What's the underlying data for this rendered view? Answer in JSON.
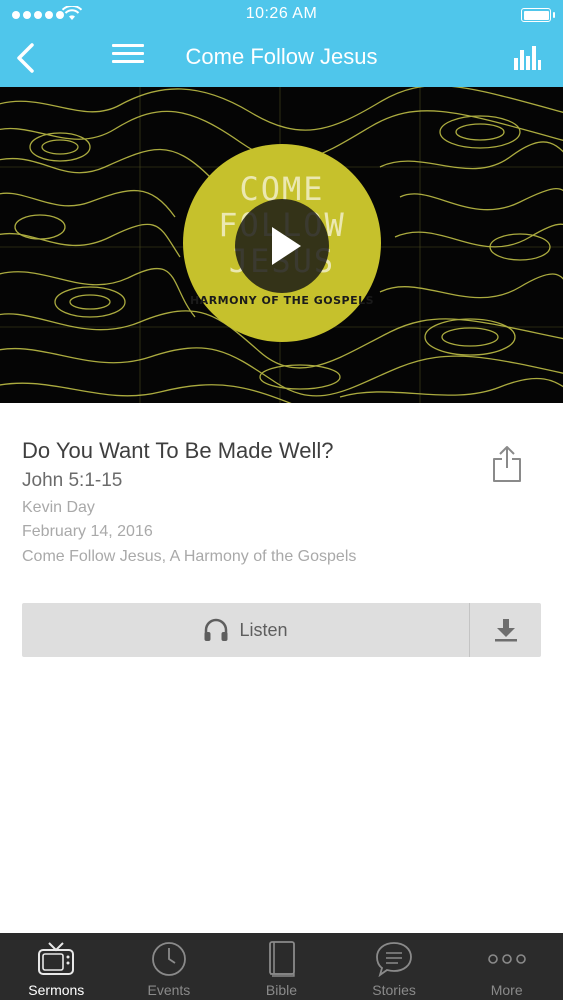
{
  "status_bar": {
    "time": "10:26 AM"
  },
  "nav": {
    "title": "Come Follow Jesus"
  },
  "artwork": {
    "title_lines": [
      "COME",
      "FOLLOW",
      "JESUS"
    ],
    "subtitle": "HARMONY OF THE GOSPELS",
    "circle_color": "#c6c12c",
    "line_color": "#c8c84a"
  },
  "sermon": {
    "title": "Do You Want To Be Made Well?",
    "scripture": "John 5:1-15",
    "speaker": "Kevin Day",
    "date": "February 14, 2016",
    "series": "Come Follow Jesus, A Harmony of the Gospels"
  },
  "actions": {
    "listen_label": "Listen"
  },
  "tabs": [
    {
      "label": "Sermons",
      "icon": "tv-icon",
      "active": true
    },
    {
      "label": "Events",
      "icon": "clock-icon",
      "active": false
    },
    {
      "label": "Bible",
      "icon": "book-icon",
      "active": false
    },
    {
      "label": "Stories",
      "icon": "chat-bubble-icon",
      "active": false
    },
    {
      "label": "More",
      "icon": "more-dots-icon",
      "active": false
    }
  ],
  "colors": {
    "accent": "#4fc6eb",
    "tabbar": "#2b2b2b"
  }
}
